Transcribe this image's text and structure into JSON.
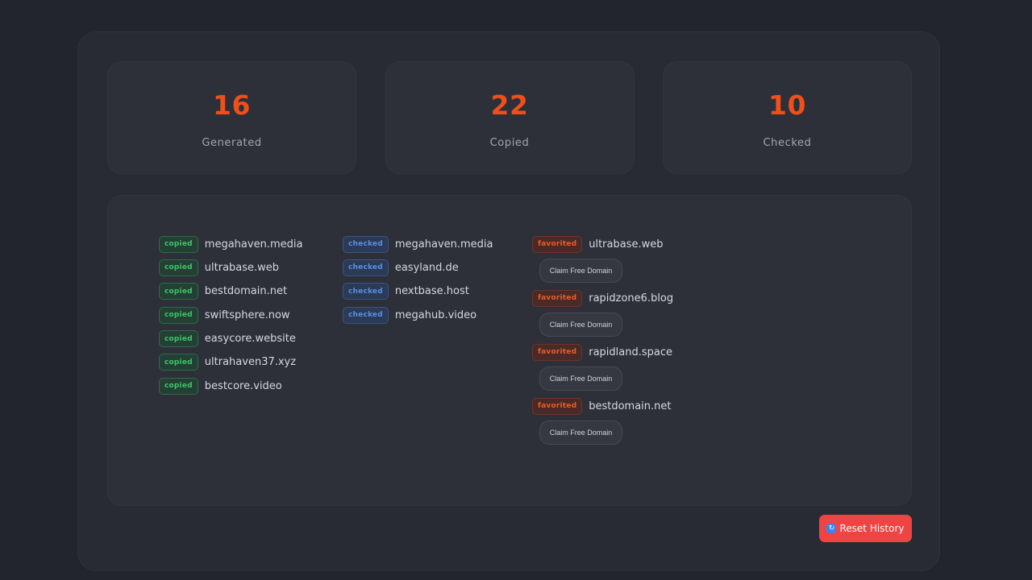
{
  "stats": [
    {
      "value": "16",
      "label": "Generated"
    },
    {
      "value": "22",
      "label": "Copied"
    },
    {
      "value": "10",
      "label": "Checked"
    }
  ],
  "copied": {
    "badge": "copied",
    "items": [
      "megahaven.media",
      "ultrabase.web",
      "bestdomain.net",
      "swiftsphere.now",
      "easycore.website",
      "ultrahaven37.xyz",
      "bestcore.video"
    ]
  },
  "checked": {
    "badge": "checked",
    "items": [
      "megahaven.media",
      "easyland.de",
      "nextbase.host",
      "megahub.video"
    ]
  },
  "favorited": {
    "badge": "favorited",
    "claim_label": "Claim Free Domain",
    "items": [
      "ultrabase.web",
      "rapidzone6.blog",
      "rapidland.space",
      "bestdomain.net"
    ]
  },
  "reset": {
    "icon": "refresh-icon",
    "label": "Reset History"
  }
}
